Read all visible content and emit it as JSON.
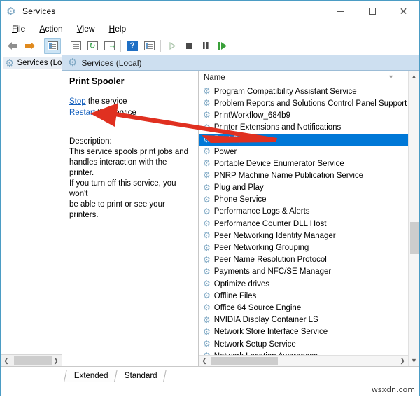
{
  "window": {
    "title": "Services",
    "title_icon": "services-gear-icon",
    "controls": {
      "minimize": "–",
      "maximize": "□",
      "close": "✕"
    }
  },
  "menu": [
    {
      "label": "File",
      "accel": "F"
    },
    {
      "label": "Action",
      "accel": "A"
    },
    {
      "label": "View",
      "accel": "V"
    },
    {
      "label": "Help",
      "accel": "H"
    }
  ],
  "toolbar": {
    "items": [
      {
        "name": "back-icon",
        "glyph": "←"
      },
      {
        "name": "forward-icon",
        "glyph": "→"
      },
      {
        "name": "show-hide-console-tree-icon",
        "glyph": ""
      },
      {
        "name": "properties-icon",
        "glyph": ""
      },
      {
        "name": "refresh-icon",
        "glyph": "↻"
      },
      {
        "name": "export-list-icon",
        "glyph": ""
      },
      {
        "name": "help-icon",
        "glyph": "?"
      },
      {
        "name": "show-hide-action-pane-icon",
        "glyph": ""
      },
      {
        "name": "start-service-icon",
        "glyph": "▶"
      },
      {
        "name": "stop-service-icon",
        "glyph": ""
      },
      {
        "name": "pause-service-icon",
        "glyph": "‖"
      },
      {
        "name": "restart-service-icon",
        "glyph": "▷"
      }
    ]
  },
  "tree": {
    "root_label": "Services (Loca"
  },
  "right_header": {
    "label": "Services (Local)",
    "icon": "services-node-icon"
  },
  "detail": {
    "service_name": "Print Spooler",
    "links": [
      {
        "link_text": "Stop",
        "suffix": " the service"
      },
      {
        "link_text": "Restart",
        "suffix": " the service"
      }
    ],
    "description_label": "Description:",
    "description_lines": [
      "This service spools print jobs and",
      "handles interaction with the printer.",
      "If you turn off this service, you won't",
      "be able to print or see your printers."
    ]
  },
  "list": {
    "column_header": "Name",
    "selected_index": 4,
    "rows": [
      "Program Compatibility Assistant Service",
      "Problem Reports and Solutions Control Panel Support",
      "PrintWorkflow_684b9",
      "Printer Extensions and Notifications",
      "Print Spooler",
      "Power",
      "Portable Device Enumerator Service",
      "PNRP Machine Name Publication Service",
      "Plug and Play",
      "Phone Service",
      "Performance Logs & Alerts",
      "Performance Counter DLL Host",
      "Peer Networking Identity Manager",
      "Peer Networking Grouping",
      "Peer Name Resolution Protocol",
      "Payments and NFC/SE Manager",
      "Optimize drives",
      "Offline Files",
      "Office 64 Source Engine",
      "NVIDIA Display Container LS",
      "Network Store Interface Service",
      "Network Setup Service",
      "Network Location Awareness"
    ]
  },
  "tabs": [
    {
      "label": "Extended",
      "active": false
    },
    {
      "label": "Standard",
      "active": true
    }
  ],
  "watermark": "wsxdn.com",
  "colors": {
    "selection_blue": "#0078d7",
    "header_blue": "#cddff0",
    "link_blue": "#1560bd",
    "annotation_red": "#e03020",
    "window_border": "#4b9cc4"
  }
}
